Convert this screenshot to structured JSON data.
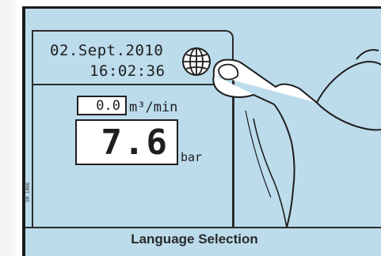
{
  "display": {
    "date": "02.Sept.2010",
    "time": "16:02:36",
    "flow_value": "0.0",
    "flow_unit": "m³/min",
    "pressure_value": "7.6",
    "pressure_unit": "bar",
    "side_code": "SM 1006"
  },
  "caption": "Language Selection",
  "icons": {
    "language": "globe-icon"
  },
  "colors": {
    "panel_bg": "#bcdcec",
    "value_box_bg": "#ffffff"
  }
}
